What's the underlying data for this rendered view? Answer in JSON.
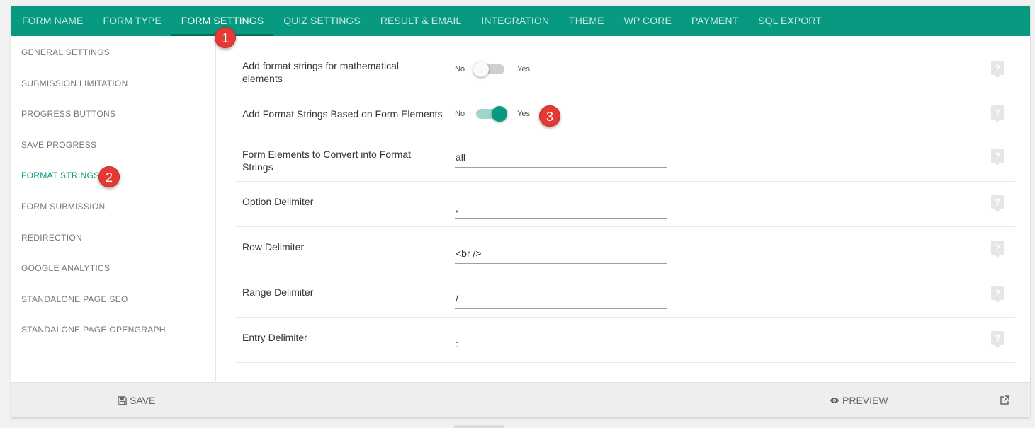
{
  "topbar": {
    "tabs": [
      {
        "label": "FORM NAME"
      },
      {
        "label": "FORM TYPE"
      },
      {
        "label": "FORM SETTINGS"
      },
      {
        "label": "QUIZ SETTINGS"
      },
      {
        "label": "RESULT & EMAIL"
      },
      {
        "label": "INTEGRATION"
      },
      {
        "label": "THEME"
      },
      {
        "label": "WP CORE"
      },
      {
        "label": "PAYMENT"
      },
      {
        "label": "SQL EXPORT"
      }
    ],
    "active_tab": "FORM SETTINGS",
    "color": "#079a80"
  },
  "sidebar": {
    "items": [
      {
        "label": "GENERAL SETTINGS"
      },
      {
        "label": "SUBMISSION LIMITATION"
      },
      {
        "label": "PROGRESS BUTTONS"
      },
      {
        "label": "SAVE PROGRESS"
      },
      {
        "label": "FORMAT STRINGS"
      },
      {
        "label": "FORM SUBMISSION"
      },
      {
        "label": "REDIRECTION"
      },
      {
        "label": "GOOGLE ANALYTICS"
      },
      {
        "label": "STANDALONE PAGE SEO"
      },
      {
        "label": "STANDALONE PAGE OPENGRAPH"
      }
    ],
    "active_item": "FORMAT STRINGS"
  },
  "settings": {
    "math_format": {
      "label": "Add format strings for mathematical elements",
      "no": "No",
      "yes": "Yes",
      "enabled": false
    },
    "form_format": {
      "label": "Add Format Strings Based on Form Elements",
      "no": "No",
      "yes": "Yes",
      "enabled": true
    },
    "convert_elements": {
      "label": "Form Elements to Convert into Format Strings",
      "value": "all"
    },
    "option_delimiter": {
      "label": "Option Delimiter",
      "value": ","
    },
    "row_delimiter": {
      "label": "Row Delimiter",
      "value": "<br />"
    },
    "range_delimiter": {
      "label": "Range Delimiter",
      "value": "/"
    },
    "entry_delimiter": {
      "label": "Entry Delimiter",
      "value": ":"
    }
  },
  "help_icon": "?",
  "footer": {
    "save_label": "SAVE",
    "preview_label": "PREVIEW"
  },
  "annotations": {
    "badge_1": "1",
    "badge_2": "2",
    "badge_3": "3",
    "color": "#e53935"
  }
}
